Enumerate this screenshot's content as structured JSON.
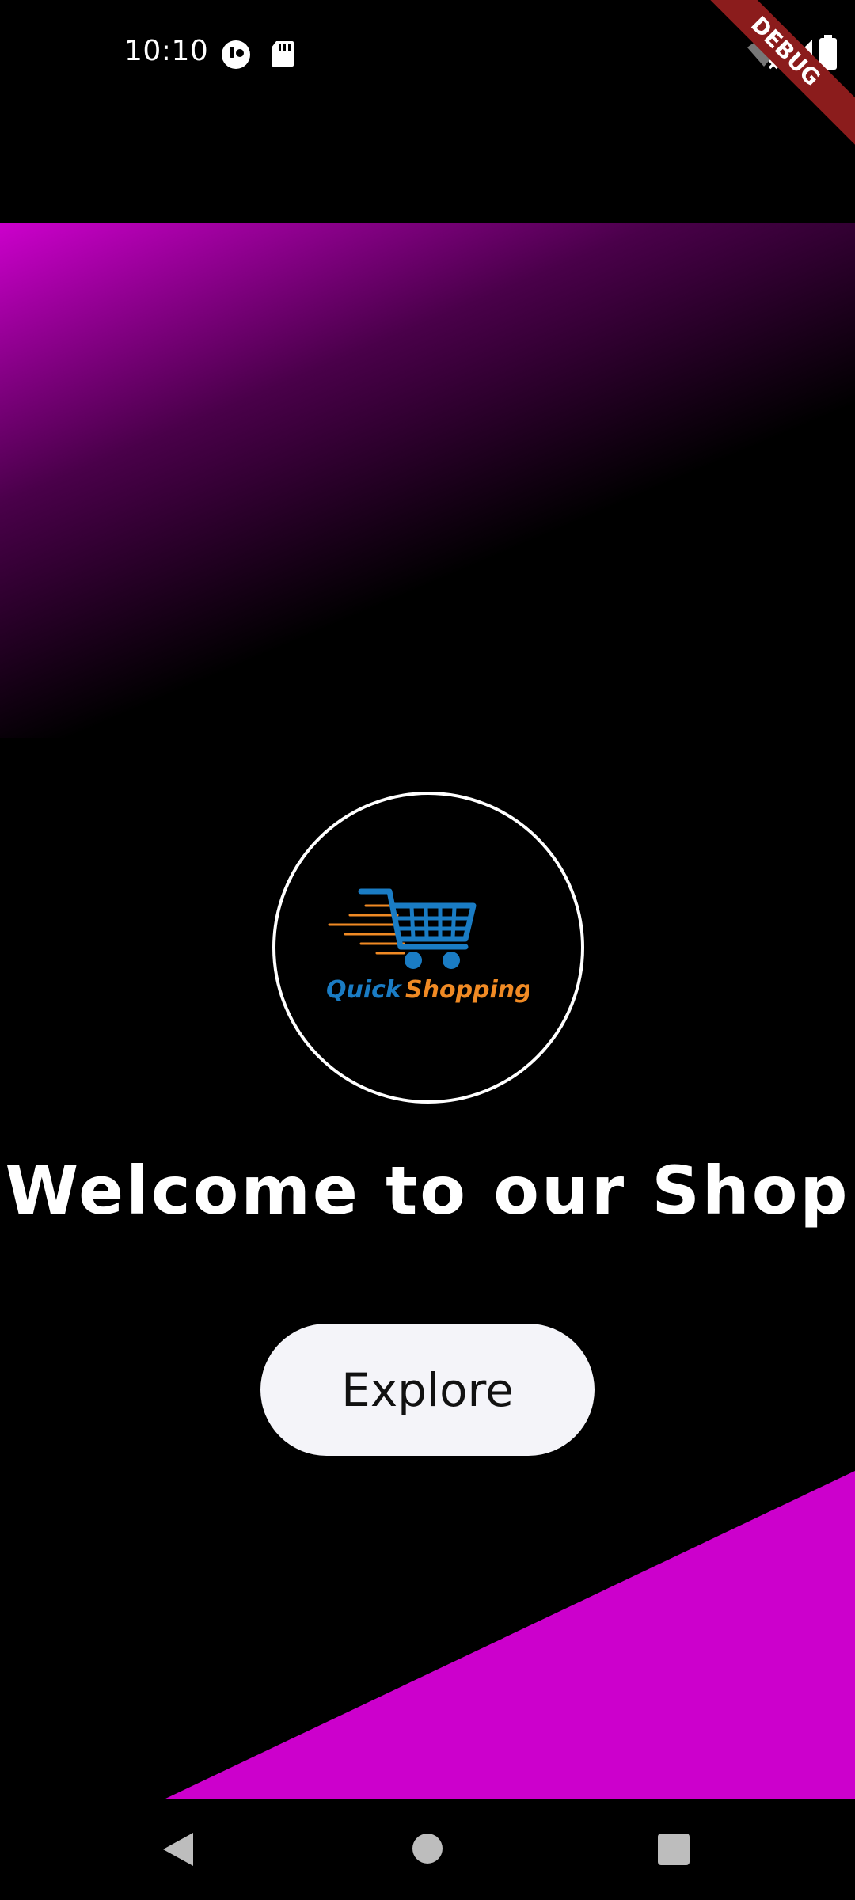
{
  "status_bar": {
    "time": "10:10",
    "icons": [
      "notification-icon",
      "sd-card-icon",
      "wifi-off-icon",
      "signal-icon",
      "battery-icon"
    ]
  },
  "debug_banner": {
    "label": "DEBUG",
    "color": "#8b1c1c"
  },
  "logo": {
    "word1": "Quick",
    "word2": "Shopping",
    "colors": {
      "blue": "#1a7cc4",
      "orange": "#f08a24"
    }
  },
  "welcome": {
    "title": "Welcome to our Shop"
  },
  "explore_button": {
    "label": "Explore"
  },
  "theme": {
    "background": "#000000",
    "accent": "#cc00cc",
    "button_bg": "#f4f4f9"
  },
  "nav_bar": {
    "icons": [
      "back-icon",
      "home-icon",
      "recents-icon"
    ]
  }
}
